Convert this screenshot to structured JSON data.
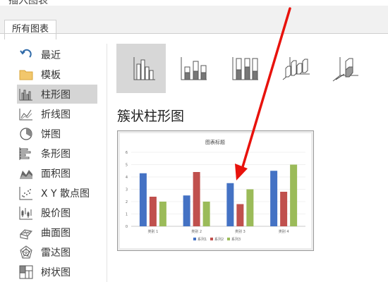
{
  "dialog": {
    "title": "插入图表"
  },
  "tabs": [
    {
      "label": "所有图表"
    }
  ],
  "sidebar": {
    "items": [
      {
        "label": "最近",
        "icon": "recent-icon"
      },
      {
        "label": "模板",
        "icon": "folder-icon"
      },
      {
        "label": "柱形图",
        "icon": "column-chart-icon"
      },
      {
        "label": "折线图",
        "icon": "line-chart-icon"
      },
      {
        "label": "饼图",
        "icon": "pie-chart-icon"
      },
      {
        "label": "条形图",
        "icon": "bar-chart-icon"
      },
      {
        "label": "面积图",
        "icon": "area-chart-icon"
      },
      {
        "label": "X Y 散点图",
        "icon": "scatter-chart-icon"
      },
      {
        "label": "股价图",
        "icon": "stock-chart-icon"
      },
      {
        "label": "曲面图",
        "icon": "surface-chart-icon"
      },
      {
        "label": "雷达图",
        "icon": "radar-chart-icon"
      },
      {
        "label": "树状图",
        "icon": "treemap-chart-icon"
      }
    ],
    "selected_index": 2
  },
  "subtypes": {
    "items": [
      "clustered-column-icon",
      "stacked-column-icon",
      "100-stacked-column-icon",
      "3d-clustered-column-icon",
      "3d-stacked-column-icon",
      "3d-100-stacked-column-icon"
    ],
    "selected_index": 0
  },
  "section": {
    "title": "簇状柱形图"
  },
  "colors": {
    "series1": "#4472c4",
    "series2": "#c0504d",
    "series3": "#9bbb59",
    "arrow": "#e8120c",
    "selected_bg": "#d5d5d5"
  },
  "chart_data": {
    "type": "bar",
    "title": "图表标题",
    "categories": [
      "类别 1",
      "类别 2",
      "类别 3",
      "类别 4"
    ],
    "series": [
      {
        "name": "系列1",
        "values": [
          4.3,
          2.5,
          3.5,
          4.5
        ]
      },
      {
        "name": "系列2",
        "values": [
          2.4,
          4.4,
          1.8,
          2.8
        ]
      },
      {
        "name": "系列3",
        "values": [
          2,
          2,
          3,
          5
        ]
      }
    ],
    "ylim": [
      0,
      6
    ],
    "yticks": [
      "0",
      "1",
      "2",
      "3",
      "4",
      "5",
      "6"
    ],
    "grid": true,
    "legend": "bottom"
  }
}
